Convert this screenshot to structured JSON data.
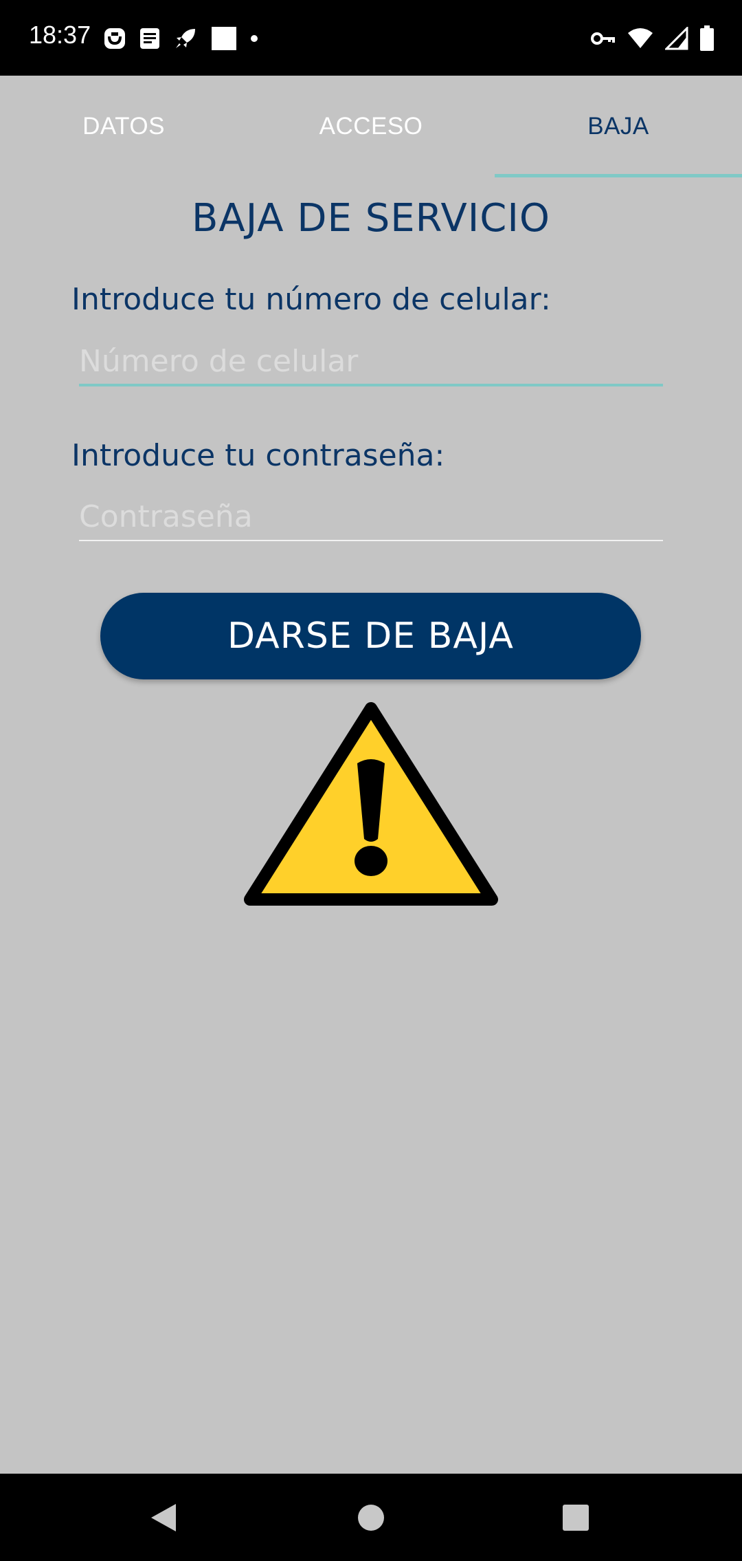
{
  "status_bar": {
    "time": "18:37",
    "left_icons": [
      "moustache-app-icon",
      "notes-icon",
      "rocket-icon",
      "square-app-icon",
      "dot-icon"
    ],
    "right_icons": [
      "vpn-key-icon",
      "wifi-icon",
      "signal-icon",
      "battery-icon"
    ]
  },
  "tabs": [
    {
      "label": "DATOS",
      "active": false
    },
    {
      "label": "ACCESO",
      "active": false
    },
    {
      "label": "BAJA",
      "active": true
    }
  ],
  "page": {
    "title": "BAJA DE SERVICIO",
    "phone": {
      "label": "Introduce tu número de celular:",
      "placeholder": "Número de celular",
      "value": ""
    },
    "password": {
      "label": "Introduce tu contraseña:",
      "placeholder": "Contraseña",
      "value": ""
    },
    "submit_label": "DARSE DE BAJA",
    "warning_icon": "warning-triangle-icon"
  },
  "nav_bar": {
    "buttons": [
      "back-icon",
      "home-icon",
      "recents-icon"
    ]
  },
  "colors": {
    "background": "#c4c4c4",
    "primary": "#003566",
    "accent": "#7fc9c6",
    "warning_yellow": "#ffd02a"
  }
}
